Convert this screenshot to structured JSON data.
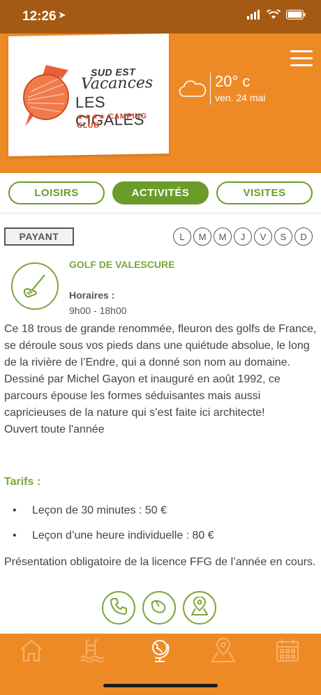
{
  "status_bar": {
    "time": "12:26",
    "location_glyph": "➤"
  },
  "header": {
    "logo": {
      "line1": "SUD EST",
      "line2": "Vacances",
      "line3": "LES CIGALES",
      "line4": "★★★★ CAMPING CLUB"
    },
    "weather": {
      "icon": "cloud-icon",
      "temperature": "20° c",
      "date": "ven. 24 mai"
    },
    "menu_icon": "hamburger-icon"
  },
  "tabs": [
    {
      "label": "LOISIRS",
      "active": false
    },
    {
      "label": "ACTIVITÉS",
      "active": true
    },
    {
      "label": "VISITES",
      "active": false
    }
  ],
  "activity": {
    "badge": "PAYANT",
    "days": [
      "L",
      "M",
      "M",
      "J",
      "V",
      "S",
      "D"
    ],
    "icon": "golf-club-icon",
    "title": "GOLF DE VALESCURE",
    "hours_label": "Horaires :",
    "hours": "9h00 - 18h00",
    "description": [
      "Ce 18 trous de grande renommée, fleuron des golfs de France, se déroule sous vos pieds dans une quiétude absolue, le long de la rivière de l’Endre, qui a donné son nom au domaine.",
      "Dessiné par Michel Gayon et inauguré en août 1992, ce parcours épouse les formes séduisantes mais aussi capricieuses de la nature qui s’est faite ici architecte!",
      "Ouvert toute l'année"
    ],
    "tarifs_title": "Tarifs :",
    "tarifs": [
      "Leçon de 30 minutes : 50 €",
      "Leçon d’une heure individuelle : 80 €"
    ],
    "note": "Présentation obligatoire de la licence FFG de l’année en cours.",
    "actions": [
      "phone-icon",
      "email-icon",
      "map-icon"
    ]
  },
  "bottom_nav": [
    "home-icon",
    "pool-icon",
    "globe-icon",
    "map-pin-icon",
    "calendar-icon"
  ],
  "colors": {
    "orange": "#ee8a25",
    "dark_orange": "#a45a12",
    "green": "#6a9c2a"
  }
}
